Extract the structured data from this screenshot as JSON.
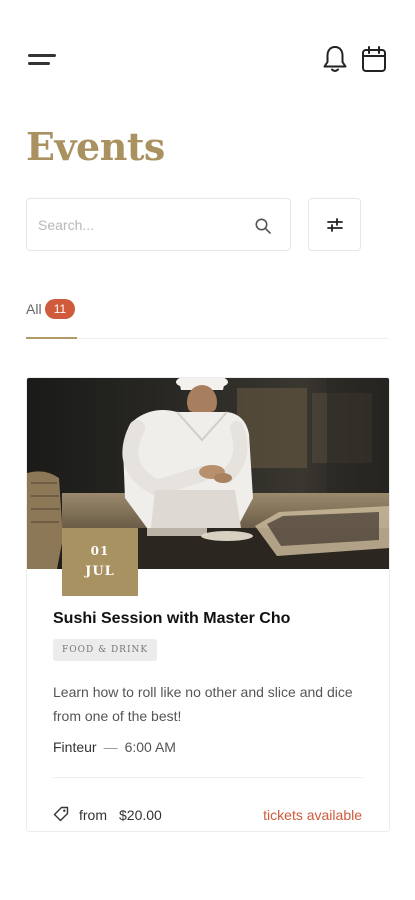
{
  "header": {
    "menu_icon": "hamburger-menu-icon",
    "notification_icon": "bell-icon",
    "calendar_icon": "calendar-icon"
  },
  "page": {
    "title": "Events"
  },
  "search": {
    "placeholder": "Search...",
    "value": "",
    "icon": "search-icon"
  },
  "filter": {
    "icon": "sliders-icon"
  },
  "tabs": [
    {
      "label": "All",
      "count": "11",
      "active": true
    }
  ],
  "events": [
    {
      "image": "chef-preparing-sushi-photo",
      "date_day": "01",
      "date_month": "JUL",
      "title": "Sushi Session with Master Cho",
      "category": "FOOD & DRINK",
      "description": "Learn how to roll like no other and slice and dice from one of the best!",
      "venue": "Finteur",
      "separator": "—",
      "time": "6:00 AM",
      "price_prefix": "from",
      "price": "$20.00",
      "tickets_status": "tickets available"
    }
  ],
  "colors": {
    "accent_gold": "#a99260",
    "badge_red": "#cf5a3c",
    "status_red": "#cf5a3c"
  }
}
